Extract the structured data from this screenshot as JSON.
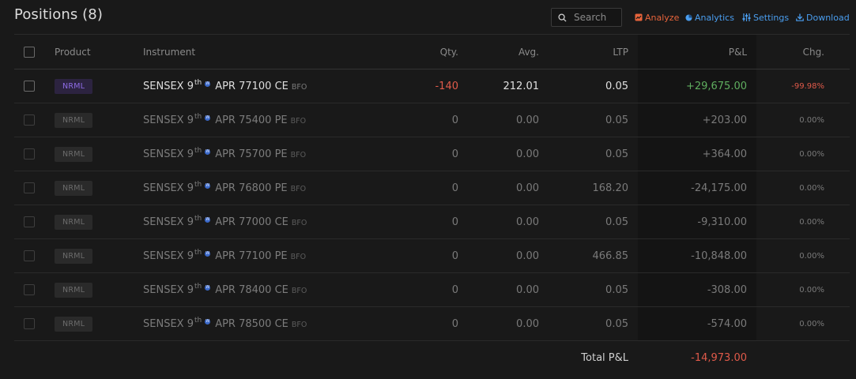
{
  "header": {
    "title": "Positions (8)",
    "search_placeholder": "Search",
    "analyze_label": "Analyze",
    "analytics_label": "Analytics",
    "settings_label": "Settings",
    "download_label": "Download"
  },
  "columns": {
    "product": "Product",
    "instrument": "Instrument",
    "qty": "Qty.",
    "avg": "Avg.",
    "ltp": "LTP",
    "pnl": "P&L",
    "chg": "Chg."
  },
  "rows": [
    {
      "product": "NRML",
      "name_prefix": "SENSEX 9",
      "sup": "th",
      "name_suffix": "APR 77100 CE",
      "exchange": "BFO",
      "qty": "-140",
      "avg": "212.01",
      "ltp": "0.05",
      "pnl": "+29,675.00",
      "chg": "-99.98%"
    },
    {
      "product": "NRML",
      "name_prefix": "SENSEX 9",
      "sup": "th",
      "name_suffix": "APR 75400 PE",
      "exchange": "BFO",
      "qty": "0",
      "avg": "0.00",
      "ltp": "0.05",
      "pnl": "+203.00",
      "chg": "0.00%"
    },
    {
      "product": "NRML",
      "name_prefix": "SENSEX 9",
      "sup": "th",
      "name_suffix": "APR 75700 PE",
      "exchange": "BFO",
      "qty": "0",
      "avg": "0.00",
      "ltp": "0.05",
      "pnl": "+364.00",
      "chg": "0.00%"
    },
    {
      "product": "NRML",
      "name_prefix": "SENSEX 9",
      "sup": "th",
      "name_suffix": "APR 76800 PE",
      "exchange": "BFO",
      "qty": "0",
      "avg": "0.00",
      "ltp": "168.20",
      "pnl": "-24,175.00",
      "chg": "0.00%"
    },
    {
      "product": "NRML",
      "name_prefix": "SENSEX 9",
      "sup": "th",
      "name_suffix": "APR 77000 CE",
      "exchange": "BFO",
      "qty": "0",
      "avg": "0.00",
      "ltp": "0.05",
      "pnl": "-9,310.00",
      "chg": "0.00%"
    },
    {
      "product": "NRML",
      "name_prefix": "SENSEX 9",
      "sup": "th",
      "name_suffix": "APR 77100 PE",
      "exchange": "BFO",
      "qty": "0",
      "avg": "0.00",
      "ltp": "466.85",
      "pnl": "-10,848.00",
      "chg": "0.00%"
    },
    {
      "product": "NRML",
      "name_prefix": "SENSEX 9",
      "sup": "th",
      "name_suffix": "APR 78400 CE",
      "exchange": "BFO",
      "qty": "0",
      "avg": "0.00",
      "ltp": "0.05",
      "pnl": "-308.00",
      "chg": "0.00%"
    },
    {
      "product": "NRML",
      "name_prefix": "SENSEX 9",
      "sup": "th",
      "name_suffix": "APR 78500 CE",
      "exchange": "BFO",
      "qty": "0",
      "avg": "0.00",
      "ltp": "0.05",
      "pnl": "-574.00",
      "chg": "0.00%"
    }
  ],
  "total": {
    "label": "Total P&L",
    "value": "-14,973.00"
  },
  "colors": {
    "background": "#191919",
    "profit": "#5fae5f",
    "loss": "#e05a4a",
    "link": "#4a9ef0",
    "analyze": "#e8643b",
    "product_badge": "#8e6ce6"
  },
  "icons": {
    "search": "search-icon",
    "analyze": "analyze-icon",
    "analytics": "analytics-icon",
    "settings": "sliders-icon",
    "download": "download-icon",
    "weekly": "weekly-expiry-icon"
  }
}
